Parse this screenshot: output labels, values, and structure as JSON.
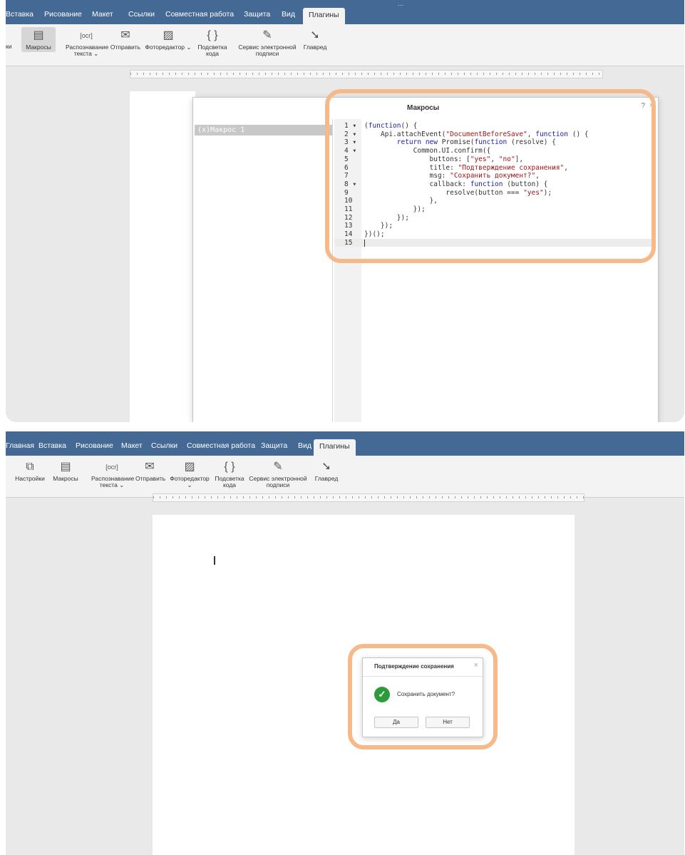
{
  "top": {
    "window_title": "...",
    "tabs": [
      "Вставка",
      "Рисование",
      "Макет",
      "Ссылки",
      "Совместная работа",
      "Защита",
      "Вид",
      "Плагины"
    ],
    "active_tab": "Плагины",
    "toolbar": [
      {
        "icon": "macros-icon",
        "label": "Макросы"
      },
      {
        "icon": "ocr-icon",
        "label": "Распознавание текста ⌄"
      },
      {
        "icon": "envelope-icon",
        "label": "Отправить"
      },
      {
        "icon": "photo-editor-icon",
        "label": "Фоторедактор ⌄"
      },
      {
        "icon": "braces-icon",
        "label": "Подсветка кода"
      },
      {
        "icon": "signature-icon",
        "label": "Сервис электронной подписи"
      },
      {
        "icon": "typograf-icon",
        "label": "Главред"
      }
    ],
    "toolbar_left_fragment": "ки",
    "macros_dialog": {
      "title": "Макросы",
      "help": "?",
      "macro_item": "(x)Макрос 1",
      "code_lines": [
        {
          "n": "1",
          "fold": "▾",
          "text": "(function() {"
        },
        {
          "n": "2",
          "fold": "▾",
          "text": "    Api.attachEvent(\"DocumentBeforeSave\", function () {"
        },
        {
          "n": "3",
          "fold": "▾",
          "text": "        return new Promise(function (resolve) {"
        },
        {
          "n": "4",
          "fold": "▾",
          "text": "            Common.UI.confirm({"
        },
        {
          "n": "5",
          "fold": "",
          "text": "                buttons: [\"yes\", \"no\"],"
        },
        {
          "n": "6",
          "fold": "",
          "text": "                title: \"Подтверждение сохранения\","
        },
        {
          "n": "7",
          "fold": "",
          "text": "                msg: \"Сохранить документ?\","
        },
        {
          "n": "8",
          "fold": "▾",
          "text": "                callback: function (button) {"
        },
        {
          "n": "9",
          "fold": "",
          "text": "                    resolve(button === \"yes\");"
        },
        {
          "n": "10",
          "fold": "",
          "text": "                },"
        },
        {
          "n": "11",
          "fold": "",
          "text": "            });"
        },
        {
          "n": "12",
          "fold": "",
          "text": "        });"
        },
        {
          "n": "13",
          "fold": "",
          "text": "    });"
        },
        {
          "n": "14",
          "fold": "",
          "text": "})();"
        },
        {
          "n": "15",
          "fold": "",
          "text": ""
        }
      ]
    }
  },
  "bottom": {
    "tabs": [
      "Главная",
      "Вставка",
      "Рисование",
      "Макет",
      "Ссылки",
      "Совместная работа",
      "Защита",
      "Вид",
      "Плагины"
    ],
    "active_tab": "Плагины",
    "toolbar": [
      {
        "icon": "puzzle-icon",
        "label": "Настройки"
      },
      {
        "icon": "macros-icon",
        "label": "Макросы"
      },
      {
        "icon": "ocr-icon",
        "label": "Распознавание текста ⌄"
      },
      {
        "icon": "envelope-icon",
        "label": "Отправить"
      },
      {
        "icon": "photo-editor-icon",
        "label": "Фоторедактор ⌄"
      },
      {
        "icon": "braces-icon",
        "label": "Подсветка кода"
      },
      {
        "icon": "signature-icon",
        "label": "Сервис электронной подписи"
      },
      {
        "icon": "typograf-icon",
        "label": "Главред"
      }
    ],
    "confirm_dialog": {
      "title": "Подтверждение сохранения",
      "message": "Сохранить документ?",
      "yes_label": "Да",
      "no_label": "Нет",
      "accent_color": "#2e9b3a"
    }
  },
  "colors": {
    "tabbar": "#446995",
    "highlight": "#f5b98a"
  }
}
